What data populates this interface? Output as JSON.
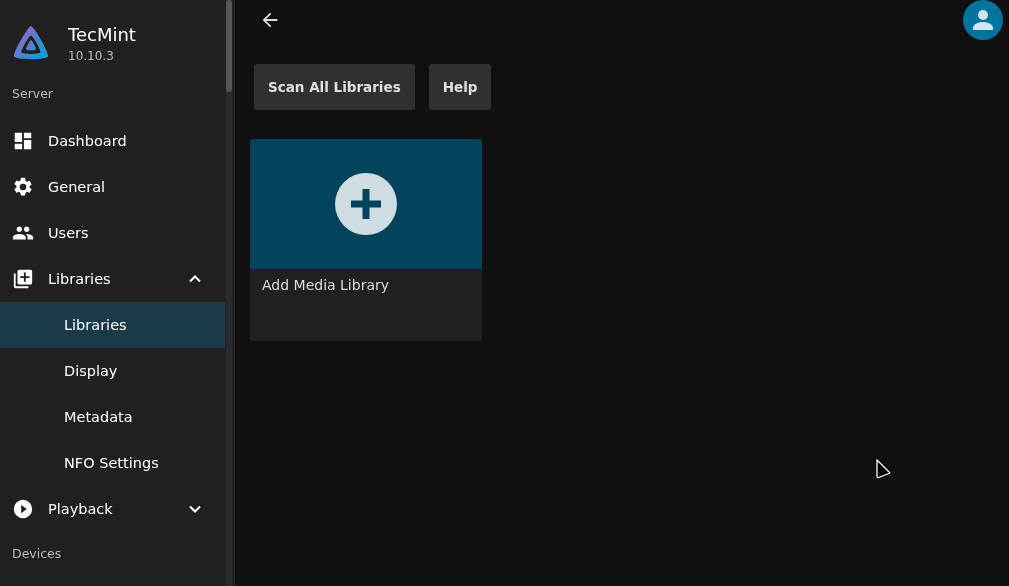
{
  "app": {
    "name": "TecMint",
    "version": "10.10.3"
  },
  "sidebar": {
    "sections": [
      {
        "header": "Server",
        "items": [
          {
            "label": "Dashboard",
            "selected": false
          },
          {
            "label": "General",
            "selected": false
          },
          {
            "label": "Users",
            "selected": false
          },
          {
            "label": "Libraries",
            "selected": false,
            "expanded": true,
            "children": [
              {
                "label": "Libraries",
                "selected": true
              },
              {
                "label": "Display",
                "selected": false
              },
              {
                "label": "Metadata",
                "selected": false
              },
              {
                "label": "NFO Settings",
                "selected": false
              }
            ]
          },
          {
            "label": "Playback",
            "selected": false,
            "expanded": false
          }
        ]
      },
      {
        "header": "Devices"
      }
    ]
  },
  "toolbar": {
    "buttons": [
      "Scan All Libraries",
      "Help"
    ]
  },
  "cards": [
    {
      "title": "Add Media Library"
    }
  ]
}
